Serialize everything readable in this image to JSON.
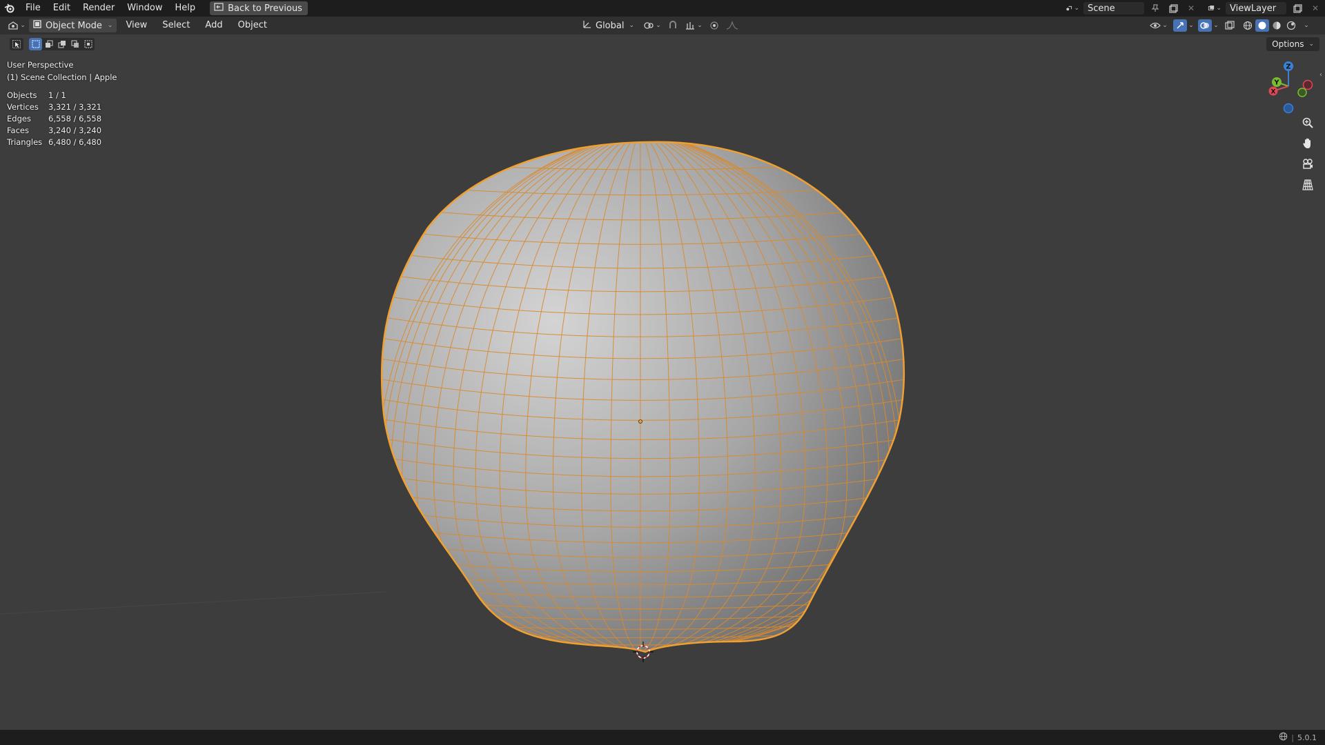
{
  "topbar": {
    "menus": [
      "File",
      "Edit",
      "Render",
      "Window",
      "Help"
    ],
    "back_button": "Back to Previous",
    "scene": "Scene",
    "view_layer": "ViewLayer"
  },
  "viewport_header": {
    "mode": "Object Mode",
    "menus": [
      "View",
      "Select",
      "Add",
      "Object"
    ],
    "orientation": "Global"
  },
  "options_label": "Options",
  "overlay": {
    "view_name": "User Perspective",
    "collection": "(1) Scene Collection | Apple"
  },
  "stats": [
    {
      "label": "Objects",
      "value": "1 / 1"
    },
    {
      "label": "Vertices",
      "value": "3,321 / 3,321"
    },
    {
      "label": "Edges",
      "value": "6,558 / 6,558"
    },
    {
      "label": "Faces",
      "value": "3,240 / 3,240"
    },
    {
      "label": "Triangles",
      "value": "6,480 / 6,480"
    }
  ],
  "gizmo_axes": {
    "x": "X",
    "y": "Y",
    "z": "Z"
  },
  "version": "5.0.1",
  "colors": {
    "selection": "#f0a030",
    "active_button": "#4772b3",
    "axis_x": "#e04856",
    "axis_y": "#7bbd30",
    "axis_z": "#3a82d8"
  }
}
